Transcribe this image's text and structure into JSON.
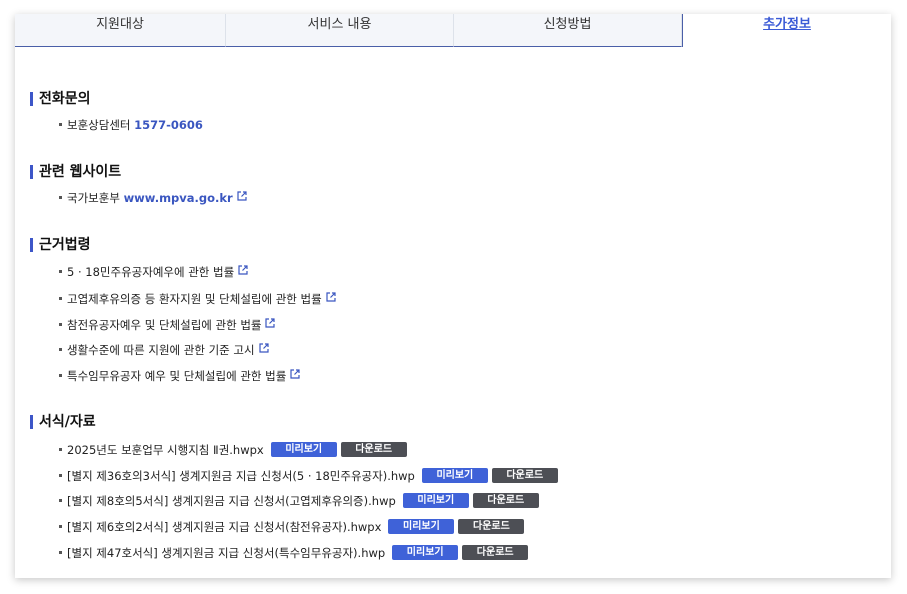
{
  "tabs": [
    {
      "label": "지원대상"
    },
    {
      "label": "서비스 내용"
    },
    {
      "label": "신청방법"
    },
    {
      "label": "추가정보"
    }
  ],
  "phone": {
    "title": "전화문의",
    "items": [
      {
        "label": "보훈상담센터",
        "value": "1577-0606"
      }
    ]
  },
  "websites": {
    "title": "관련 웹사이트",
    "items": [
      {
        "label": "국가보훈부",
        "value": "www.mpva.go.kr",
        "icon": "external-link-icon"
      }
    ]
  },
  "laws": {
    "title": "근거법령",
    "items": [
      {
        "label": "5 · 18민주유공자예우에 관한 법률"
      },
      {
        "label": "고엽제후유의증 등 환자지원 및 단체설립에 관한 법률"
      },
      {
        "label": "참전유공자예우 및 단체설립에 관한 법률"
      },
      {
        "label": "생활수준에 따른 지원에 관한 기준 고시"
      },
      {
        "label": "특수임무유공자 예우 및 단체설립에 관한 법률"
      }
    ]
  },
  "forms": {
    "title": "서식/자료",
    "preview_label": "미리보기",
    "download_label": "다운로드",
    "items": [
      {
        "label": "2025년도 보훈업무 시행지침 Ⅱ권.hwpx"
      },
      {
        "label": "[별지 제36호의3서식] 생계지원금 지급 신청서(5 · 18민주유공자).hwp"
      },
      {
        "label": "[별지 제8호의5서식] 생계지원금 지급 신청서(고엽제후유의증).hwp"
      },
      {
        "label": "[별지 제6호의2서식] 생계지원금 지급 신청서(참전유공자).hwpx"
      },
      {
        "label": "[별지 제47호서식] 생계지원금 지급 신청서(특수임무유공자).hwp"
      }
    ]
  },
  "colors": {
    "accent": "#3d56c8",
    "preview_button": "#3f62d8",
    "download_button": "#4d4f55"
  }
}
